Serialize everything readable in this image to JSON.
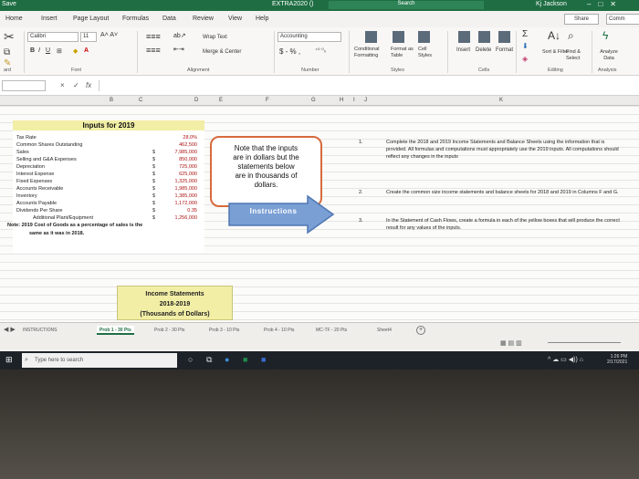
{
  "window": {
    "title": "EXTRA2020 ()",
    "search": "Search",
    "user": "Kj Jackson",
    "quick_access": "Save"
  },
  "ribbon_tabs": [
    "Home",
    "Insert",
    "Page Layout",
    "Formulas",
    "Data",
    "Review",
    "View",
    "Help"
  ],
  "active_tab": "Home",
  "share_label": "Share",
  "comments_label": "Comm",
  "ribbon": {
    "font_name": "Calibri",
    "font_size": "11",
    "bold": "B",
    "italic": "I",
    "underline": "U",
    "wrap_text": "Wrap Text",
    "merge_center": "Merge & Center",
    "number_format": "Accounting",
    "currency": "$ - % ,",
    "conditional_formatting": "Conditional Formatting",
    "format_as_table": "Format as Table",
    "cell_styles": "Cell Styles",
    "insert": "Insert",
    "delete": "Delete",
    "format": "Format",
    "sort_filter": "Sort & Filter",
    "find_select": "Find & Select",
    "analyze_data": "Analyze Data",
    "groups": {
      "clipboard": "ard",
      "font": "Font",
      "alignment": "Alignment",
      "number": "Number",
      "styles": "Styles",
      "cells": "Cells",
      "editing": "Editing",
      "analysis": "Analysis"
    }
  },
  "formula_bar": {
    "cancel": "×",
    "enter": "✓",
    "fx": "fx",
    "value": ""
  },
  "columns": [
    "B",
    "C",
    "D",
    "E",
    "F",
    "G",
    "H",
    "I",
    "J",
    "K"
  ],
  "inputs": {
    "title": "Inputs for 2019",
    "rows": [
      {
        "label": "Tax Rate",
        "currency": "",
        "value": "28.0%"
      },
      {
        "label": "Common Shares Outstanding",
        "currency": "",
        "value": "462,500"
      },
      {
        "label": "Sales",
        "currency": "$",
        "value": "7,985,000"
      },
      {
        "label": "Selling and G&A Expenses",
        "currency": "$",
        "value": "850,000"
      },
      {
        "label": "Depreciation",
        "currency": "$",
        "value": "725,000"
      },
      {
        "label": "Interest Expense",
        "currency": "$",
        "value": "625,000"
      },
      {
        "label": "Fixed Expenses",
        "currency": "$",
        "value": "1,325,000"
      },
      {
        "label": "Accounts Receivable",
        "currency": "$",
        "value": "1,985,000"
      },
      {
        "label": "Inventory",
        "currency": "$",
        "value": "1,385,000"
      },
      {
        "label": "Accounts Payable",
        "currency": "$",
        "value": "1,172,000"
      },
      {
        "label": "Dividends Per Share",
        "currency": "$",
        "value": "0.35"
      },
      {
        "label": "Additional Plant/Equipment",
        "currency": "$",
        "value": "1,256,000"
      }
    ],
    "note_line1": "Note: 2019 Cost of Goods as a percentage of sales is the",
    "note_line2": "same as it was in 2018."
  },
  "note_box": {
    "line1": "Note that the inputs",
    "line2": "are in dollars but the",
    "line3": "statements below",
    "line4": "are in thousands of",
    "line5": "dollars."
  },
  "instructions_arrow": "Instructions",
  "instructions": [
    {
      "num": "1.",
      "text": "Complete the 2018 and 2019 Income Statements and Balance Sheets using the information that is provided. All formulas and computations must appropriately use the 2019 inputs. All computations should reflect any changes in the inputs"
    },
    {
      "num": "2.",
      "text": "Create the common size income statements and balance sheets for 2018 and 2019 in Columns F and G."
    },
    {
      "num": "3.",
      "text": "In the Statement of Cash Flows, create a formula in each of the yellow boxes that will produce the correct result for any values of the inputs."
    }
  ],
  "income_statement": {
    "line1": "Income Statements",
    "line2": "2018-2019",
    "line3": "(Thousands of Dollars)"
  },
  "sheet_tabs": [
    "INSTRUCTIONS",
    "Prob 1 - 30 Pts",
    "Prob 2 - 30 Pts",
    "Prob 3 - 10 Pts",
    "Prob 4 - 10 Pts",
    "MC-TF - 20 Pts",
    "Sheet4"
  ],
  "active_sheet": "Prob 1 - 30 Pts",
  "taskbar": {
    "search_placeholder": "Type here to search",
    "time": "1:26 PM",
    "date": "2/17/2021"
  }
}
